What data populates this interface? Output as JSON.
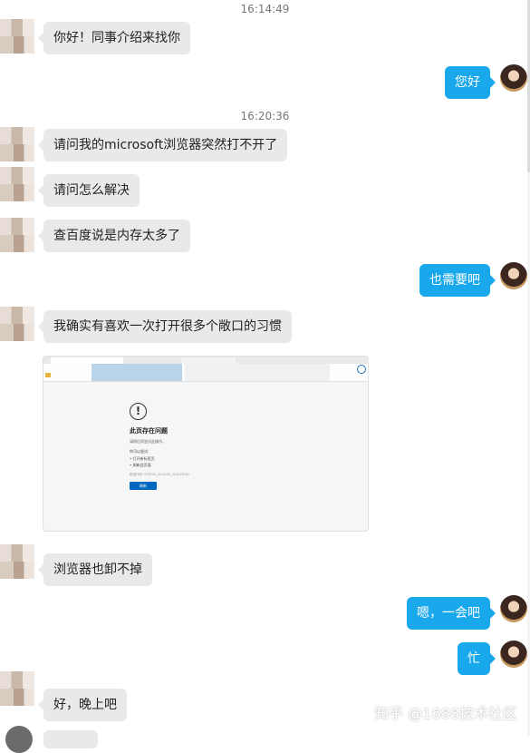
{
  "timestamps": [
    "16:14:49",
    "16:20:36"
  ],
  "messages": [
    {
      "side": "left",
      "text": "你好！同事介绍来找你"
    },
    {
      "side": "right",
      "text": "您好"
    },
    {
      "side": "left",
      "text": "请问我的microsoft浏览器突然打不开了"
    },
    {
      "side": "left",
      "text": "请问怎么解决"
    },
    {
      "side": "left",
      "text": "查百度说是内存太多了"
    },
    {
      "side": "right",
      "text": "也需要吧"
    },
    {
      "side": "left",
      "text": "我确实有喜欢一次打开很多个敞口的习惯"
    },
    {
      "side": "left",
      "text": "浏览器也卸不掉"
    },
    {
      "side": "right",
      "text": "嗯，一会吧"
    },
    {
      "side": "right",
      "text": "忙"
    },
    {
      "side": "left",
      "text": "好，晚上吧"
    }
  ],
  "screenshot": {
    "error_icon": "!",
    "title": "此页存在问题",
    "subtitle": "请稍后再尝试此操作。",
    "try_label": "你可以尝试:",
    "bullet1": "•  打开新标签页",
    "bullet2": "•  刷新此页面",
    "error_code": "错误代码: STATUS_ACCESS_VIOLATION",
    "refresh_button": "刷新"
  },
  "watermark": "知乎 @1688技术社区",
  "colors": {
    "outgoing": "#1aa8ec",
    "incoming": "#e9e9e9"
  }
}
